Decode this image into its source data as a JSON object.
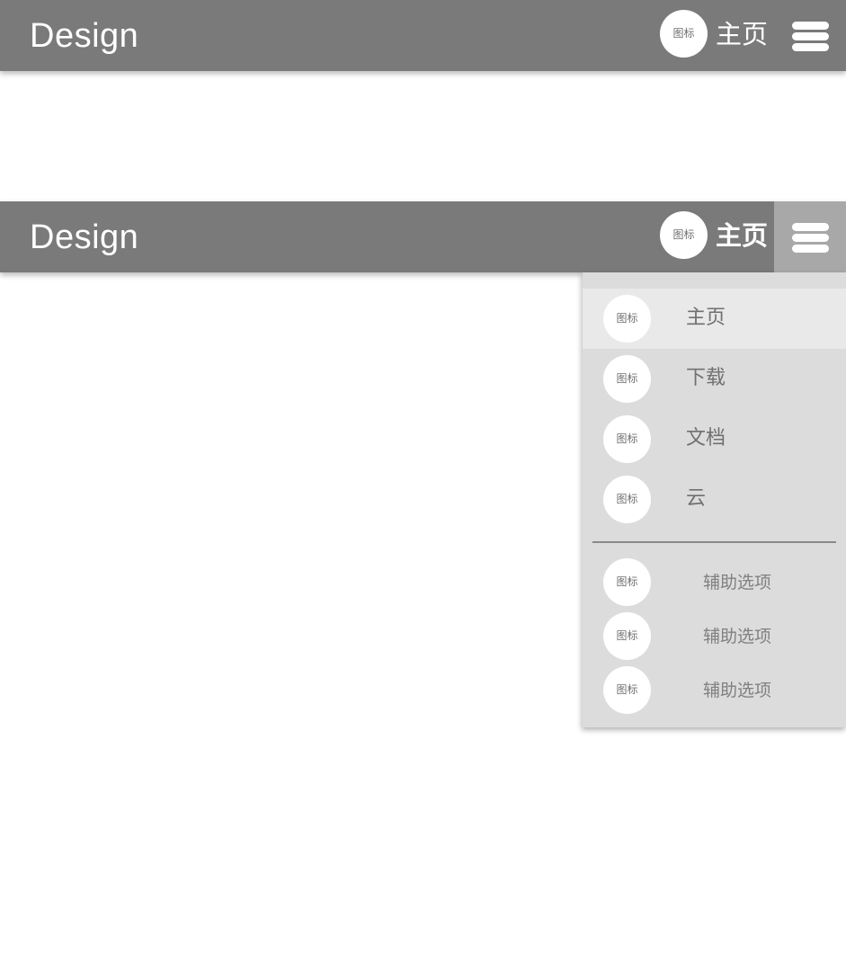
{
  "brand": "Design",
  "icon_placeholder": "图标",
  "top_bar": {
    "title": "主页"
  },
  "second_bar": {
    "title": "主页"
  },
  "dropdown": {
    "items": [
      {
        "label": "主页",
        "icon": "图标"
      },
      {
        "label": "下载",
        "icon": "图标"
      },
      {
        "label": "文档",
        "icon": "图标"
      },
      {
        "label": "云",
        "icon": "图标"
      }
    ],
    "secondary": [
      {
        "label": "辅助选项",
        "icon": "图标"
      },
      {
        "label": "辅助选项",
        "icon": "图标"
      },
      {
        "label": "辅助选项",
        "icon": "图标"
      }
    ]
  },
  "colors": {
    "appbar": "#7a7a7a",
    "menu_active": "#a8a8a8",
    "dropdown_bg": "#dcdcdc",
    "item_active": "#e9e9e9"
  }
}
